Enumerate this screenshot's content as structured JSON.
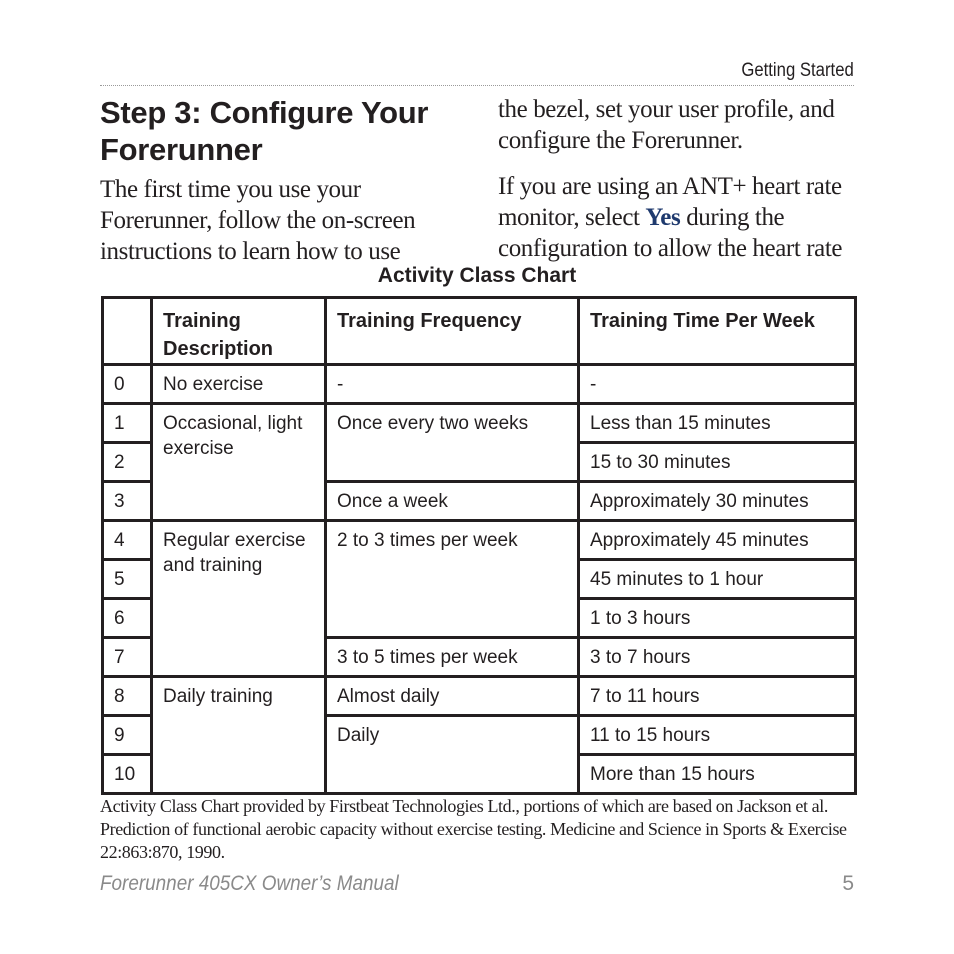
{
  "header": {
    "section": "Getting Started"
  },
  "left_column": {
    "heading": "Step 3: Configure Your Forerunner",
    "paragraph": "The first time you use your Forerunner, follow the on-screen instructions to learn how to use"
  },
  "right_column": {
    "paragraph1": "the bezel, set your user profile, and configure the Forerunner.",
    "paragraph2_before": "If you are using an ANT+ heart rate monitor, select ",
    "paragraph2_emphasis": "Yes",
    "paragraph2_after": " during the configuration to allow the heart rate"
  },
  "table": {
    "title": "Activity Class Chart",
    "headers": [
      "",
      "Training Description",
      "Training Frequency",
      "Training Time Per Week"
    ],
    "rows": [
      {
        "class": "0",
        "description": "No exercise",
        "frequency": "-",
        "time": "-"
      },
      {
        "class": "1",
        "description": "Occasional, light exercise",
        "frequency": "Once every two weeks",
        "time": "Less than 15 minutes"
      },
      {
        "class": "2",
        "description": "",
        "frequency": "",
        "time": "15 to 30 minutes"
      },
      {
        "class": "3",
        "description": "",
        "frequency": "Once a week",
        "time": "Approximately 30 minutes"
      },
      {
        "class": "4",
        "description": "Regular exercise and training",
        "frequency": "2 to 3 times per week",
        "time": "Approximately 45 minutes"
      },
      {
        "class": "5",
        "description": "",
        "frequency": "",
        "time": "45 minutes to 1 hour"
      },
      {
        "class": "6",
        "description": "",
        "frequency": "",
        "time": "1 to 3 hours"
      },
      {
        "class": "7",
        "description": "",
        "frequency": "3 to 5 times per week",
        "time": "3 to 7 hours"
      },
      {
        "class": "8",
        "description": "Daily training",
        "frequency": "Almost daily",
        "time": "7 to 11 hours"
      },
      {
        "class": "9",
        "description": "",
        "frequency": "Daily",
        "time": "11 to 15 hours"
      },
      {
        "class": "10",
        "description": "",
        "frequency": "",
        "time": "More than 15 hours"
      }
    ]
  },
  "footnote": "Activity Class Chart provided by Firstbeat Technologies Ltd., portions of which are based on Jackson et al. Prediction of functional aerobic capacity without exercise testing. Medicine and Science in Sports & Exercise 22:863:870, 1990.",
  "footer": {
    "manual_title": "Forerunner 405CX Owner’s Manual",
    "page_number": "5"
  },
  "colors": {
    "text": "#231f20",
    "emphasis": "#1f3a6e",
    "footer": "#8a8a8a"
  }
}
